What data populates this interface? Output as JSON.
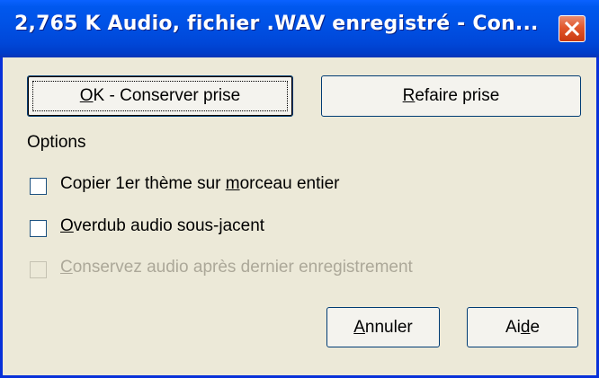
{
  "window": {
    "title": "2,765 K Audio, fichier .WAV enregistré - Con...",
    "close_label": "×"
  },
  "buttons": {
    "ok": {
      "prefix": "",
      "accel": "O",
      "rest": "K - Conserver prise"
    },
    "refaire": {
      "prefix": "",
      "accel": "R",
      "rest": "efaire prise"
    },
    "annuler": {
      "prefix": "",
      "accel": "A",
      "rest": "nnuler"
    },
    "aide": {
      "prefix": "Ai",
      "accel": "d",
      "rest": "e"
    }
  },
  "options": {
    "heading": "Options",
    "items": [
      {
        "prefix": "Copier 1er thème sur ",
        "accel": "m",
        "rest": "orceau entier",
        "checked": false,
        "enabled": true
      },
      {
        "prefix": "",
        "accel": "O",
        "rest": "verdub audio sous-jacent",
        "checked": false,
        "enabled": true
      },
      {
        "prefix": "",
        "accel": "C",
        "rest": "onservez audio après dernier enregistrement",
        "checked": false,
        "enabled": false
      }
    ]
  },
  "colors": {
    "titlebar": "#0054e3",
    "face": "#ece9d8",
    "close": "#e2572c",
    "disabled_text": "#aca899"
  }
}
